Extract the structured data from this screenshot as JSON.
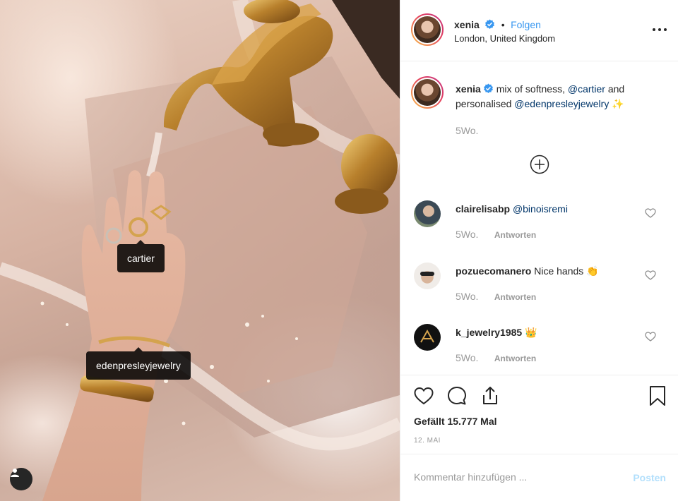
{
  "photo": {
    "tags": [
      {
        "label": "cartier"
      },
      {
        "label": "edenpresleyjewelry"
      }
    ],
    "user_tag_icon": "user-silhouette-icon"
  },
  "header": {
    "username": "xenia",
    "verified_icon": "verified-badge-icon",
    "separator": "•",
    "follow_label": "Folgen",
    "location": "London, United Kingdom",
    "more_icon": "more-options-icon"
  },
  "caption": {
    "username": "xenia",
    "text_1": "mix of softness,",
    "mention_1": "@cartier",
    "text_2": "and personalised",
    "mention_2": "@edenpresleyjewelry",
    "emoji": "✨",
    "time": "5Wo."
  },
  "load_more_icon": "plus-circle-icon",
  "comments": [
    {
      "username": "clairelisabp",
      "text": "@binoisremi",
      "time": "5Wo.",
      "reply": "Antworten"
    },
    {
      "username": "pozuecomanero",
      "text": "Nice hands",
      "emoji": "👏",
      "time": "5Wo.",
      "reply": "Antworten"
    },
    {
      "username": "k_jewelry1985",
      "text": "",
      "emoji": "👑",
      "time": "5Wo.",
      "reply": "Antworten"
    }
  ],
  "actions": {
    "like_icon": "heart-icon",
    "comment_icon": "comment-icon",
    "share_icon": "share-icon",
    "save_icon": "bookmark-icon",
    "likes_text": "Gefällt 15.777 Mal",
    "date": "12. MAI"
  },
  "comment_box": {
    "placeholder": "Kommentar hinzufügen ...",
    "post_label": "Posten"
  },
  "colors": {
    "link_blue": "#3897f0",
    "mention_blue": "#003569",
    "muted": "#999999",
    "post_disabled": "#b2dffc"
  }
}
